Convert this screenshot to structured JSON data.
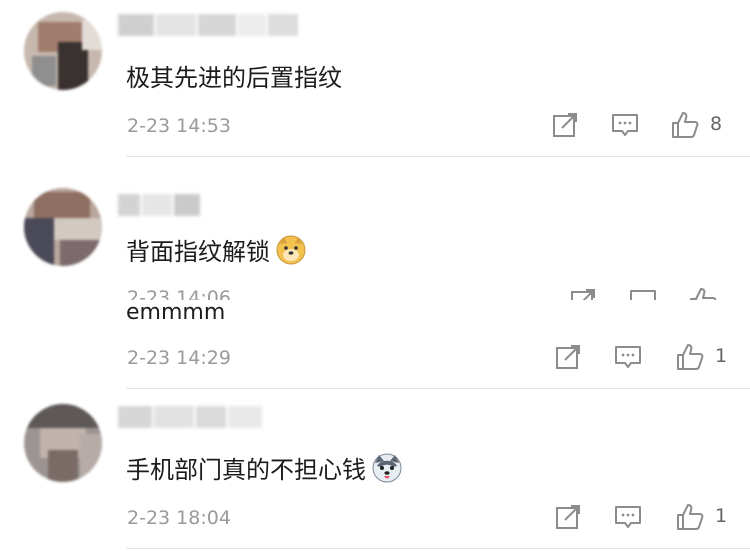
{
  "comments": [
    {
      "text": "极其先进的后置指纹",
      "time": "2-23 14:53",
      "likes": "8",
      "emoji": ""
    },
    {
      "text": "背面指纹解锁",
      "time": "2-23 14:06",
      "likes": "",
      "emoji": "doge-emoji"
    },
    {
      "text": "emmmm",
      "time": "2-23 14:29",
      "likes": "1",
      "emoji": ""
    },
    {
      "text": "手机部门真的不担心钱",
      "time": "2-23 18:04",
      "likes": "1",
      "emoji": "husky-emoji"
    }
  ],
  "icons": {
    "share": "share-icon",
    "reply": "comment-icon",
    "like": "thumbs-up-icon"
  },
  "colors": {
    "text": "#1c1c1c",
    "meta": "#9a9a9a",
    "icon": "#8c8c8c",
    "divider": "#e6e6e6"
  }
}
